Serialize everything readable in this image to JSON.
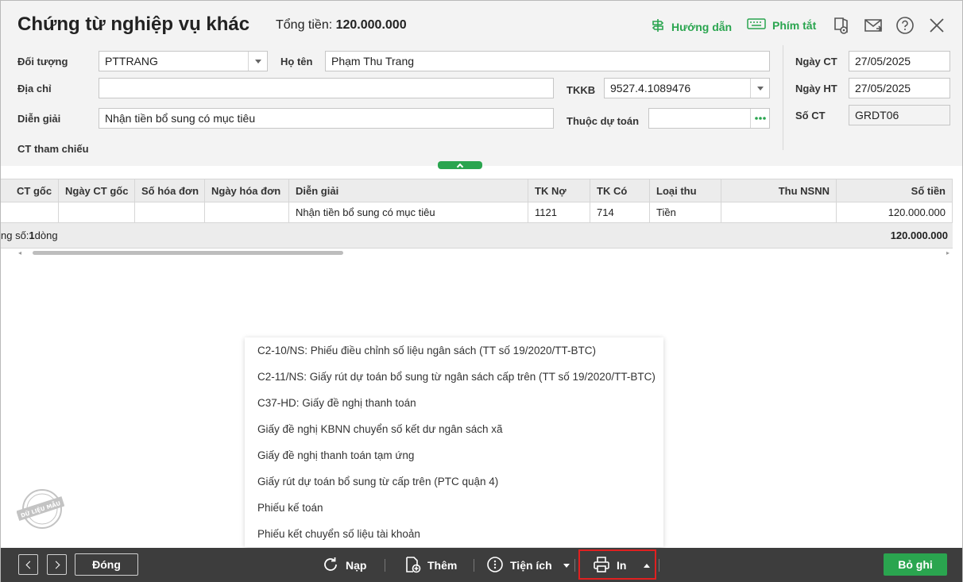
{
  "header": {
    "title": "Chứng từ nghiệp vụ khác",
    "total_label": "Tổng tiền:",
    "total_value": "120.000.000",
    "guide_label": "Hướng dẫn",
    "shortcut_label": "Phím tắt"
  },
  "form": {
    "doi_tuong_label": "Đối tượng",
    "doi_tuong_value": "PTTRANG",
    "ho_ten_label": "Họ tên",
    "ho_ten_value": "Phạm Thu Trang",
    "dia_chi_label": "Địa chỉ",
    "dia_chi_value": "",
    "tkkb_label": "TKKB",
    "tkkb_value": "9527.4.1089476",
    "dien_giai_label": "Diễn giải",
    "dien_giai_value": "Nhận tiền bổ sung có mục tiêu",
    "thuoc_du_toan_label": "Thuộc dự toán",
    "thuoc_du_toan_value": "",
    "ct_tham_chieu_label": "CT tham chiếu",
    "ngay_ct_label": "Ngày CT",
    "ngay_ct_value": "27/05/2025",
    "ngay_ht_label": "Ngày HT",
    "ngay_ht_value": "27/05/2025",
    "so_ct_label": "Số CT",
    "so_ct_value": "GRDT06"
  },
  "grid": {
    "columns": [
      "CT gốc",
      "Ngày CT gốc",
      "Số hóa đơn",
      "Ngày hóa đơn",
      "Diễn giải",
      "TK Nợ",
      "TK Có",
      "Loại thu",
      "Thu NSNN",
      "Số tiền"
    ],
    "rows": [
      [
        "",
        "",
        "",
        "",
        "Nhận tiền bổ sung có mục tiêu",
        "1121",
        "714",
        "Tiền",
        "",
        "120.000.000"
      ]
    ],
    "footer_prefix": "ng số: ",
    "footer_count": "1",
    "footer_suffix": " dòng",
    "footer_total": "120.000.000"
  },
  "print_menu": {
    "items": [
      "C2-10/NS: Phiếu điều chỉnh số liệu ngân sách (TT số 19/2020/TT-BTC)",
      "C2-11/NS: Giấy rút dự toán bổ sung từ ngân sách cấp trên (TT số 19/2020/TT-BTC)",
      "C37-HD: Giấy đề nghị thanh toán",
      "Giấy đề nghị KBNN chuyển số kết dư ngân sách xã",
      "Giấy đề nghị thanh toán tạm ứng",
      "Giấy rút dự toán bổ sung từ cấp trên (PTC quận 4)",
      "Phiếu kế toán",
      "Phiếu kết chuyển số liệu tài khoản"
    ]
  },
  "watermark": {
    "text": "DỮ LIỆU MẪU"
  },
  "footer": {
    "close_label": "Đóng",
    "reload_label": "Nạp",
    "add_label": "Thêm",
    "utility_label": "Tiện ích",
    "print_label": "In",
    "save_label": "Bỏ ghi"
  },
  "colors": {
    "accent": "#2aa54f",
    "footer_bg": "#3d3d3d",
    "highlight": "#e02020"
  }
}
